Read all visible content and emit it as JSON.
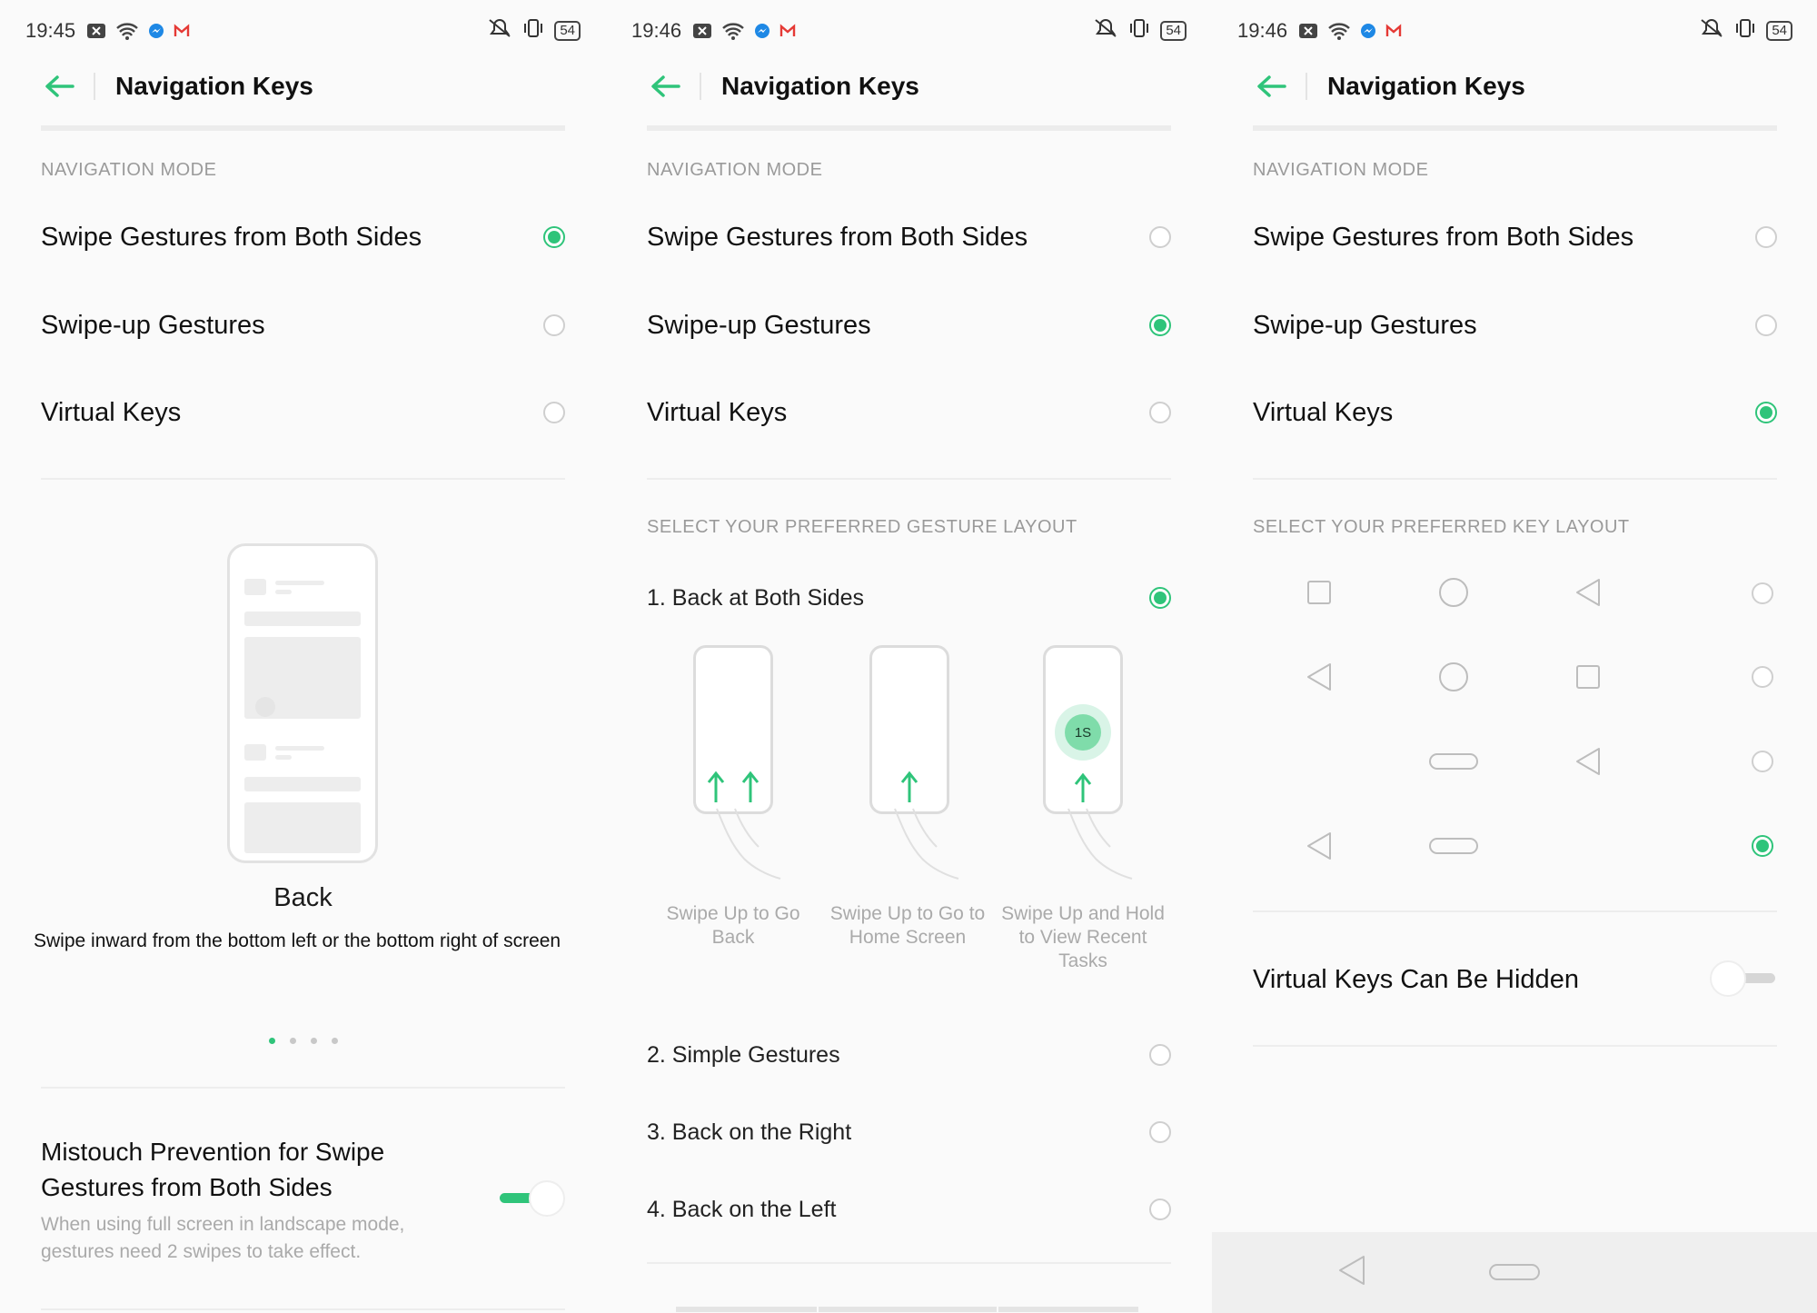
{
  "panels": [
    {
      "status": {
        "time": "19:45",
        "battery": "54"
      },
      "header": {
        "title": "Navigation Keys"
      },
      "mode_section": "NAVIGATION MODE",
      "modes": [
        {
          "label": "Swipe Gestures from Both Sides",
          "selected": true
        },
        {
          "label": "Swipe-up Gestures",
          "selected": false
        },
        {
          "label": "Virtual Keys",
          "selected": false
        }
      ],
      "carousel": {
        "title": "Back",
        "description": "Swipe inward from the bottom left or the bottom right of screen",
        "page": 1,
        "pages": 4
      },
      "mistouch": {
        "title": "Mistouch Prevention for Swipe Gestures from Both Sides",
        "description": "When using full screen in landscape mode, gestures need 2 swipes to take effect.",
        "enabled": true
      }
    },
    {
      "status": {
        "time": "19:46",
        "battery": "54"
      },
      "header": {
        "title": "Navigation Keys"
      },
      "mode_section": "NAVIGATION MODE",
      "modes": [
        {
          "label": "Swipe Gestures from Both Sides",
          "selected": false
        },
        {
          "label": "Swipe-up Gestures",
          "selected": true
        },
        {
          "label": "Virtual Keys",
          "selected": false
        }
      ],
      "layout_section": "SELECT YOUR PREFERRED GESTURE LAYOUT",
      "layouts": [
        {
          "label": "1. Back at Both Sides",
          "selected": true
        },
        {
          "label": "2. Simple Gestures",
          "selected": false
        },
        {
          "label": "3. Back on the Right",
          "selected": false
        },
        {
          "label": "4. Back on the Left",
          "selected": false
        }
      ],
      "illustrations": [
        {
          "caption": "Swipe Up to Go Back"
        },
        {
          "caption": "Swipe Up to Go to Home Screen"
        },
        {
          "caption": "Swipe Up and Hold to View Recent Tasks",
          "badge": "1S"
        }
      ]
    },
    {
      "status": {
        "time": "19:46",
        "battery": "54"
      },
      "header": {
        "title": "Navigation Keys"
      },
      "mode_section": "NAVIGATION MODE",
      "modes": [
        {
          "label": "Swipe Gestures from Both Sides",
          "selected": false
        },
        {
          "label": "Swipe-up Gestures",
          "selected": false
        },
        {
          "label": "Virtual Keys",
          "selected": true
        }
      ],
      "key_section": "SELECT YOUR PREFERRED KEY LAYOUT",
      "key_layouts": [
        {
          "keys": [
            "square-icon",
            "circle-icon",
            "triangle-left-icon"
          ],
          "selected": false
        },
        {
          "keys": [
            "triangle-left-icon",
            "circle-icon",
            "square-icon"
          ],
          "selected": false
        },
        {
          "keys": [
            "",
            "pill-icon",
            "triangle-left-icon"
          ],
          "selected": false
        },
        {
          "keys": [
            "triangle-left-icon",
            "pill-icon",
            ""
          ],
          "selected": true
        }
      ],
      "hide_keys": {
        "label": "Virtual Keys Can Be Hidden",
        "enabled": false
      }
    }
  ],
  "colors": {
    "accent": "#2fc47a",
    "divider": "#ededed",
    "muted_text": "#9a9a9a"
  }
}
